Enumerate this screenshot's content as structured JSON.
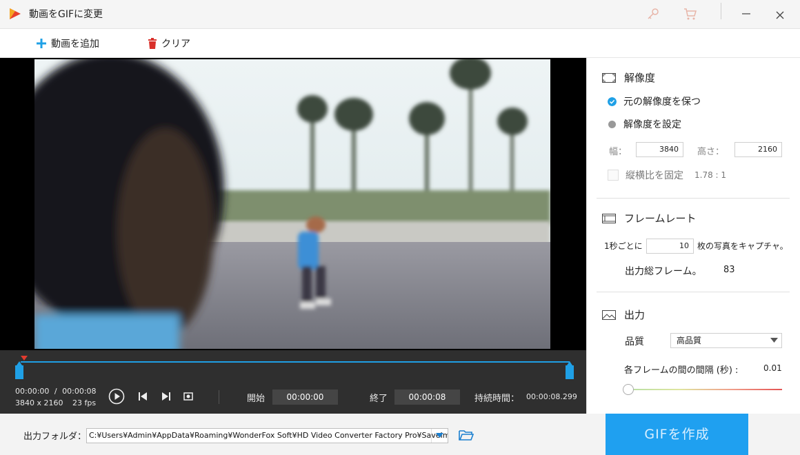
{
  "window": {
    "title": "動画をGIFに変更",
    "icons": [
      "app-logo-icon",
      "key-icon",
      "cart-icon",
      "minimize-icon",
      "close-icon"
    ]
  },
  "toolbar": {
    "add_label": "動画を追加",
    "clear_label": "クリア",
    "colors": {
      "add": "#1fa0e6",
      "clear": "#d9302a"
    }
  },
  "player": {
    "current_time": "00:00:00",
    "time_sep": "/",
    "total_time": "00:00:08",
    "resolution": "3840 x 2160",
    "fps": "23 fps",
    "start_label": "開始",
    "start_value": "00:00:00",
    "end_label": "終了",
    "end_value": "00:00:08",
    "duration_label": "持続時間：",
    "duration_value": "00:00:08.299"
  },
  "resolution": {
    "title": "解像度",
    "option_keep": "元の解像度を保つ",
    "option_set": "解像度を設定",
    "selected": "option_keep",
    "width_label": "幅：",
    "width_value": "3840",
    "height_label": "高さ：",
    "height_value": "2160",
    "aspect_label": "縦横比を固定",
    "aspect_value": "1.78 : 1"
  },
  "framerate": {
    "title": "フレームレート",
    "per_sec_label": "1秒ごとに",
    "per_sec_value": "10",
    "capture_label": "枚の写真をキャプチャ。",
    "total_label": "出力総フレーム。",
    "total_value": "83"
  },
  "output": {
    "title": "出力",
    "quality_label": "品質",
    "quality_value": "高品質",
    "interval_label": "各フレームの間の間隔 (秒) :",
    "interval_value": "0.01"
  },
  "bottom": {
    "folder_label": "出力フォルダ：",
    "path": "C:¥Users¥Admin¥AppData¥Roaming¥WonderFox Soft¥HD Video Converter Factory Pro¥SaveImage¥",
    "create_label": "GIFを作成",
    "accent": "#1fa0f0"
  }
}
